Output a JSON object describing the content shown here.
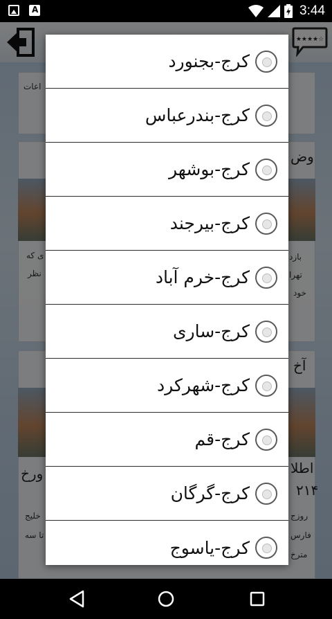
{
  "status_bar": {
    "time": "3:44"
  },
  "app": {
    "bg_snippets": [
      "اعات",
      "وض",
      "بازد",
      "تهرا",
      "خود",
      "آخ",
      "اطلا",
      "۲۱۴",
      "روزج",
      "فارس",
      "مترخ",
      "ی که",
      "نظر",
      "ورخ",
      "خلیج",
      "تا سه"
    ]
  },
  "dialog": {
    "options": [
      {
        "label": "کرج-بجنورد"
      },
      {
        "label": "کرج-بندرعباس"
      },
      {
        "label": "کرج-بوشهر"
      },
      {
        "label": "کرج-بیرجند"
      },
      {
        "label": "کرج-خرم آباد"
      },
      {
        "label": "کرج-ساری"
      },
      {
        "label": "کرج-شهرکرد"
      },
      {
        "label": "کرج-قم"
      },
      {
        "label": "کرج-گرگان"
      },
      {
        "label": "کرج-یاسوج"
      }
    ]
  }
}
